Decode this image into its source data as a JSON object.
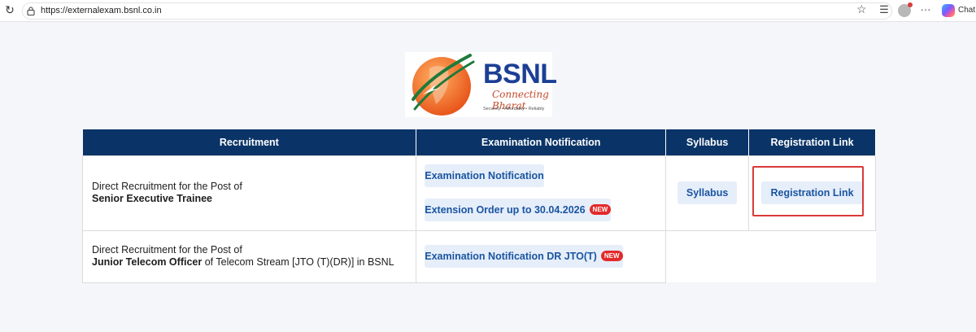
{
  "browser": {
    "url": "https://externalexam.bsnl.co.in",
    "chat_label": "Chat"
  },
  "logo": {
    "brand": "BSNL",
    "tagline": "Connecting Bharat",
    "motto": "Securely • Affordably • Reliably"
  },
  "table": {
    "headers": [
      "Recruitment",
      "Examination Notification",
      "Syllabus",
      "Registration Link"
    ],
    "rows": [
      {
        "rec_line1": "Direct Recruitment for the Post of",
        "rec_bold": "Senior Executive Trainee",
        "rec_rest": "",
        "notifications": [
          {
            "label": "Examination Notification",
            "badge": ""
          },
          {
            "label": "Extension Order up to 30.04.2026",
            "badge": "NEW"
          }
        ],
        "syllabus_label": "Syllabus",
        "registration_label": "Registration Link"
      },
      {
        "rec_line1": "Direct Recruitment for the Post of",
        "rec_bold": "Junior Telecom Officer",
        "rec_rest": " of Telecom Stream [JTO (T)(DR)] in BSNL",
        "notifications": [
          {
            "label": "Examination Notification DR JTO(T)",
            "badge": "NEW"
          }
        ]
      }
    ]
  },
  "colors": {
    "header_bg": "#0a3467",
    "button_bg": "#e6eefa",
    "button_text": "#1a55a0",
    "badge": "#e22a2a",
    "highlight": "#d93a3a"
  }
}
